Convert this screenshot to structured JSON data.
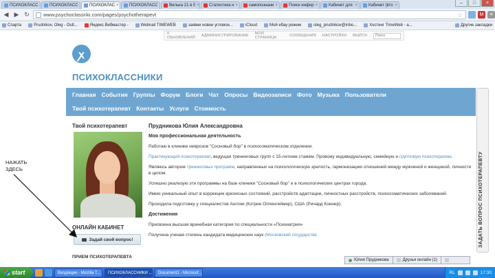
{
  "browser": {
    "tabs": [
      {
        "label": "ПСИХОКЛАСС"
      },
      {
        "label": "ПСИХОКЛАСС"
      },
      {
        "label": "ПСИХОКЛАС"
      },
      {
        "label": "ПСИХОКЛАСС"
      },
      {
        "label": "Вилька 21 в 0"
      },
      {
        "label": "Статистика н"
      },
      {
        "label": "самопознани"
      },
      {
        "label": "Поиск инфор"
      },
      {
        "label": "Кабинет для"
      },
      {
        "label": "Кабинет (вто"
      }
    ],
    "url": "www.psychoclassnki.com/pages/psychotherapevt",
    "bookmarks": [
      {
        "label": "Спарта"
      },
      {
        "label": "Prudnikov, Oleg - Outl..."
      },
      {
        "label": "Яндекс.Вебмастер -"
      },
      {
        "label": "Webnail ТIMEWEB"
      },
      {
        "label": "заявки новое угловое..."
      },
      {
        "label": "iCloud"
      },
      {
        "label": "Мой ебау режим"
      },
      {
        "label": "oleg_prudnikov@inbo..."
      },
      {
        "label": "Хостинг TimeWeb - а..."
      }
    ],
    "other_bookmarks": "Другие закладки"
  },
  "site": {
    "admin_links": [
      "0 ОБНОВЛЕНИЙ",
      "АДМИНИСТРИРОВАНИЕ",
      "МОЯ СТРАНИЦА",
      "СООБЩЕНИЯ",
      "НАСТРОЙКИ",
      "ВЫЙТИ"
    ],
    "search_placeholder": "Поиск",
    "brand": "ПСИХОКЛАССНИКИ",
    "nav_row1": [
      "Главная",
      "События",
      "Группы",
      "Форум",
      "Блоги",
      "Чат",
      "Опросы",
      "Видеозаписи",
      "Фото",
      "Музыка",
      "Пользователи"
    ],
    "nav_row2": [
      "Твой психотерапевт",
      "Контакты",
      "Услуги",
      "Стоимость"
    ]
  },
  "sidebar": {
    "title": "Твой психотерапевт",
    "online_title": "ОНЛАЙН КАБИНЕТ",
    "ask_button": "Задай свой вопрос!",
    "reception": "ПРИЕМ ПСИХОТЕРАПЕВТА"
  },
  "annotation": {
    "line1": "НАЖАТЬ",
    "line2": "ЗДЕСЬ"
  },
  "main": {
    "name": "Прудникова Юлия Александровна",
    "section_title": "Моя профессиональная деятельность",
    "p1": "Работаю в клинике неврозов \"Сосновый бор\" в психосоматическом отделении.",
    "p2_link": "Практикующий психотерапевт",
    "p2_rest": ", ведущая тренинговых групп с 15-летним стажем. Провожу индивидуальную, семейную и ",
    "p2_link2": "групповую психотерапию",
    "p2_end": ".",
    "p3_start": "Являюсь автором ",
    "p3_link": "тренинговых программ",
    "p3_rest": ", направленных на психологическую зрелость, гармонизацию отношений между мужчиной и женщиной, личности в целом.",
    "p4": "Успешно реализую эти программы на базе клиники \"Сосновый бор\" и в психологических центрах города.",
    "p5": "Имею уникальный опыт в коррекции кризисных состояний, расстройств адаптации, личностных расстройств, психосоматических заболеваний.",
    "p6": "Проходила подготовку у специалистов Англии (Кэтрин Оппенгеймер), США (Ричард Коннер).",
    "ach_title": "Достижения",
    "a1": "Присвоена высшая врачебная категория по специальности «Психиатрия»",
    "a2_start": "Получена ученая степень кандидата медицинских наук ",
    "a2_link": "(Московский государстве"
  },
  "side_tab": "ЗАДАТЬ ВОПРОС ПСИХОТЕРАПЕВТУ",
  "chat_bar": {
    "user": "Юлия Прудникова",
    "friends": "Друзья онлайн (1)"
  },
  "taskbar": {
    "start": "start",
    "tasks": [
      "Входящие - Mozilla T...",
      "ПСИХОКЛАССНИКИ ...",
      "Document1 - Microsof..."
    ],
    "lang": "RL",
    "clock": "17:30"
  }
}
